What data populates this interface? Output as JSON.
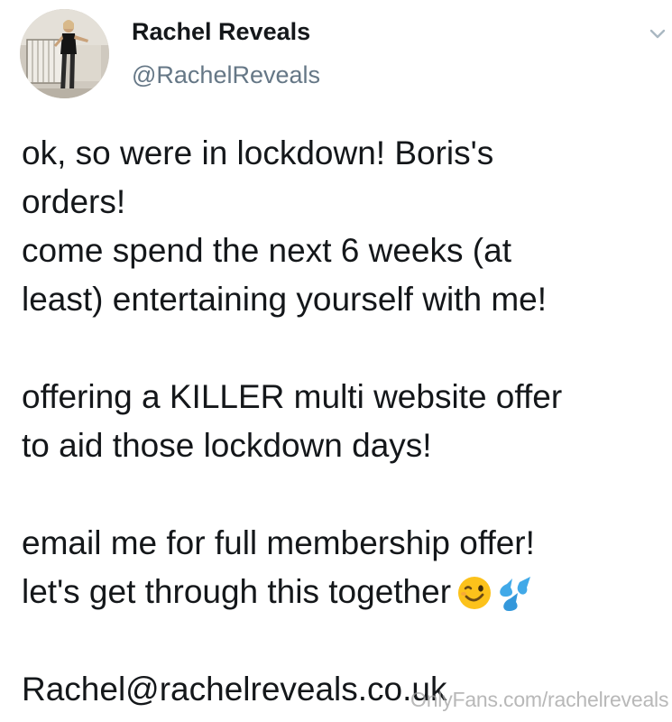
{
  "tweet": {
    "display_name": "Rachel Reveals",
    "handle": "@RachelReveals",
    "lines": {
      "l1": "ok, so were in lockdown! Boris's",
      "l2": "orders!",
      "l3": "come spend the next 6 weeks (at",
      "l4": "least) entertaining yourself with me!",
      "l5": "offering a KILLER multi website offer",
      "l6": "to aid those lockdown days!",
      "l7": "email me for full membership offer!",
      "l8": "let's get through this together",
      "email": "Rachel@rachelreveals.co.uk"
    },
    "emojis": [
      "winking-face-emoji",
      "sweat-droplets-emoji"
    ]
  },
  "watermark": {
    "text": "OnlyFans.com/rachelreveals"
  },
  "icons": {
    "caret": "chevron-down-icon"
  }
}
